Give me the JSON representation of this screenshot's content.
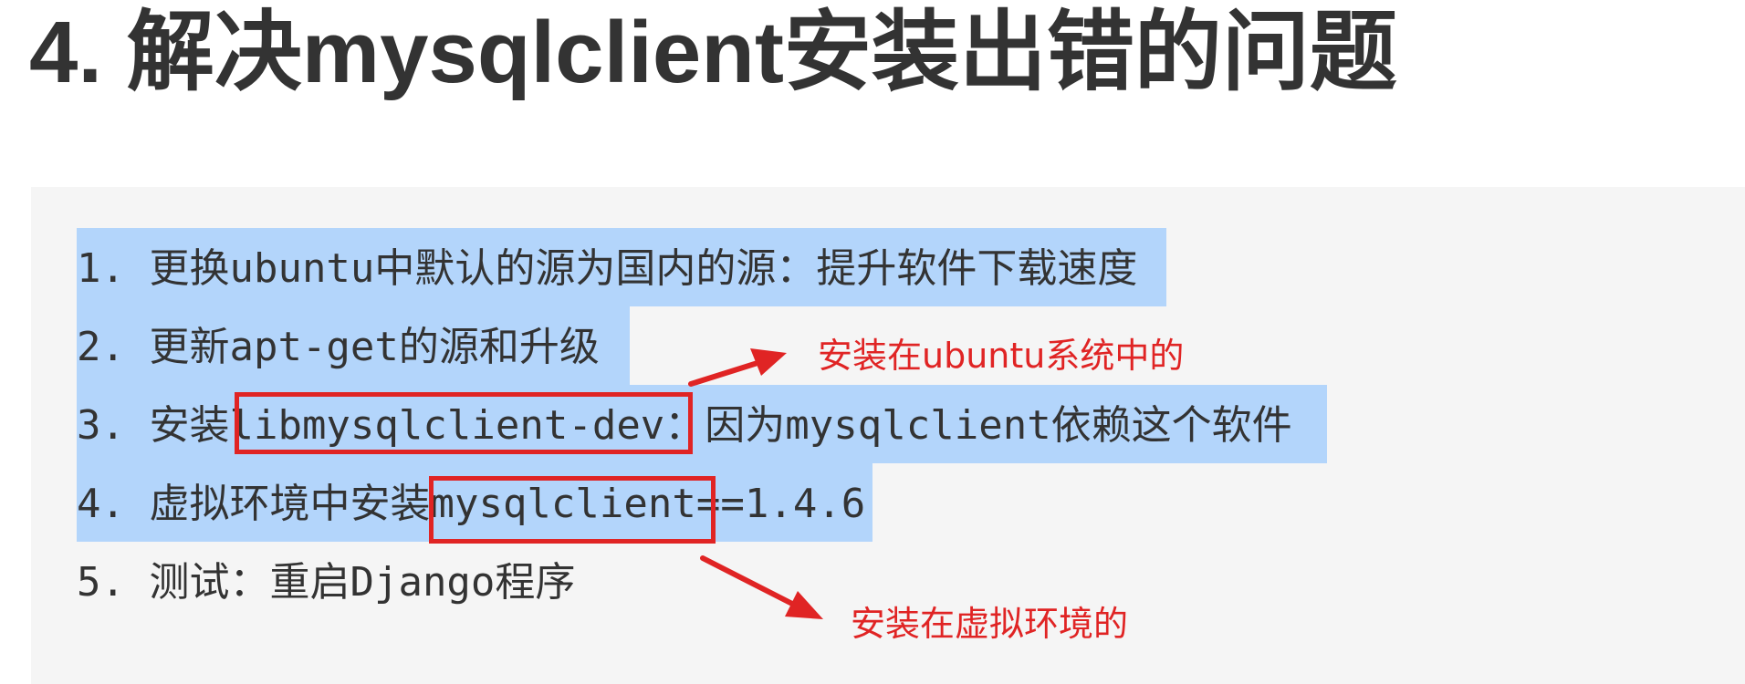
{
  "title": "4. 解决mysqlclient安装出错的问题",
  "steps": [
    "1. 更换ubuntu中默认的源为国内的源：提升软件下载速度",
    "2. 更新apt-get的源和升级",
    "3. 安装libmysqlclient-dev：因为mysqlclient依赖这个软件",
    "4. 虚拟环境中安装mysqlclient==1.4.6",
    "5. 测试：重启Django程序"
  ],
  "annotations": {
    "system_install": "安装在ubuntu系统中的",
    "venv_install": "安装在虚拟环境的"
  },
  "colors": {
    "selection": "#b3d5fb",
    "annotation_red": "#e02424",
    "code_background": "#f5f5f5",
    "text": "#333333"
  },
  "icons": [
    "arrow-right-up-icon",
    "arrow-right-down-icon"
  ]
}
